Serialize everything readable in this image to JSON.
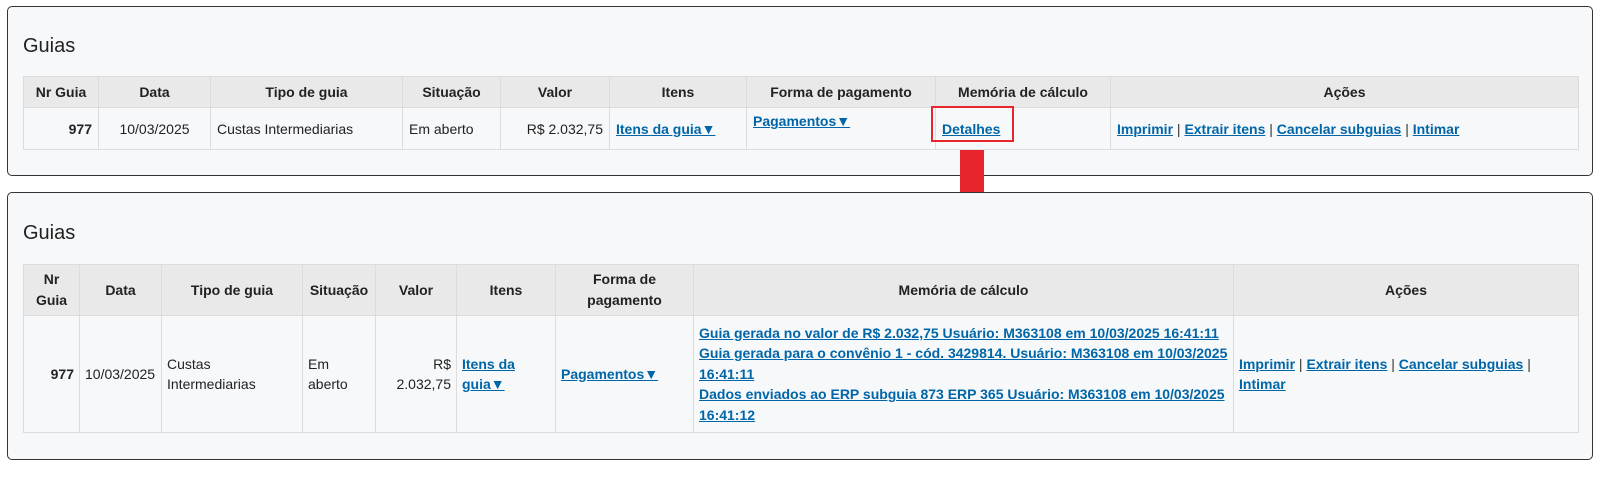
{
  "panel_before": {
    "title": "Guias",
    "headers": [
      "Nr Guia",
      "Data",
      "Tipo de guia",
      "Situação",
      "Valor",
      "Itens",
      "Forma de pagamento",
      "Memória de cálculo",
      "Ações"
    ],
    "row": {
      "nr": "977",
      "data": "10/03/2025",
      "tipo": "Custas Intermediarias",
      "situacao": "Em aberto",
      "valor": "R$ 2.032,75",
      "itens": "Itens da guia▼",
      "pagamento": "Pagamentos▼",
      "memoria": "Detalhes",
      "acoes": [
        "Imprimir",
        "Extrair itens",
        "Cancelar subguias",
        "Intimar"
      ],
      "separator": "|"
    }
  },
  "panel_after": {
    "title": "Guias",
    "headers": [
      "Nr Guia",
      "Data",
      "Tipo de guia",
      "Situação",
      "Valor",
      "Itens",
      "Forma de pagamento",
      "Memória de cálculo",
      "Ações"
    ],
    "row": {
      "nr": "977",
      "data": "10/03/2025",
      "tipo": "Custas Intermediarias",
      "situacao": "Em aberto",
      "valor": "R$ 2.032,75",
      "itens": "Itens da guia▼",
      "pagamento": "Pagamentos▼",
      "memoria": [
        "Guia gerada no valor de R$ 2.032,75 Usuário: M363108 em 10/03/2025 16:41:11",
        "Guia gerada para o convênio 1 - cód. 3429814. Usuário: M363108 em 10/03/2025 16:41:11",
        "Dados enviados ao ERP subguia 873 ERP 365 Usuário: M363108 em 10/03/2025 16:41:12"
      ],
      "acoes": [
        "Imprimir",
        "Extrair itens",
        "Cancelar subguias",
        "Intimar"
      ],
      "separator": "|"
    }
  },
  "annotations": {
    "highlight_color": "#e8242c",
    "arrow_color": "#e8242c",
    "arrow_icon": "arrow-down-icon"
  }
}
